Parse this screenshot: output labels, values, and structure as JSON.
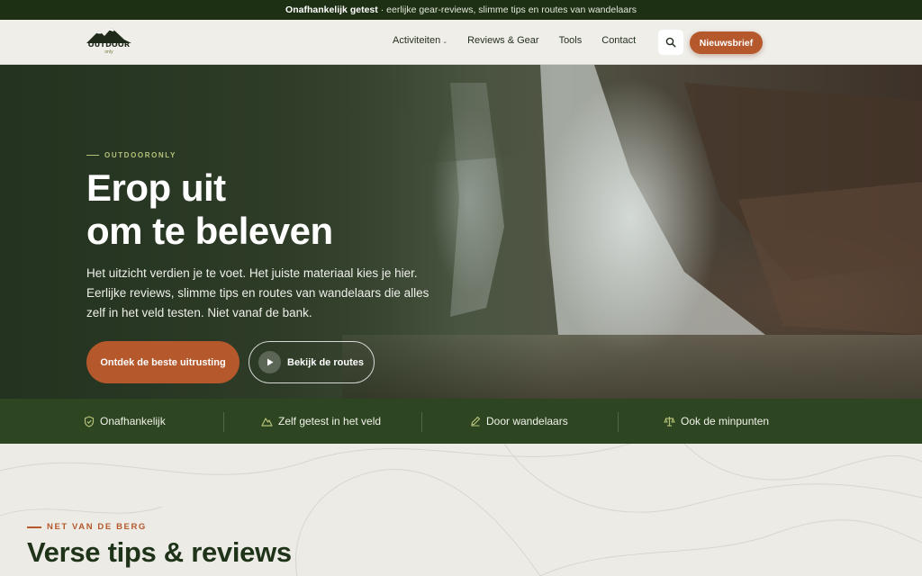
{
  "topbar": {
    "bold": "Onafhankelijk getest",
    "rest": "· eerlijke gear-reviews, slimme tips en routes van wandelaars"
  },
  "nav": {
    "logo_text": "OUTDOOR",
    "logo_sub": "only",
    "links": [
      {
        "label": "Activiteiten",
        "has_dropdown": true
      },
      {
        "label": "Reviews & Gear"
      },
      {
        "label": "Tools"
      },
      {
        "label": "Contact"
      }
    ],
    "search_icon": "search-icon",
    "newsletter_label": "Nieuwsbrief"
  },
  "hero": {
    "eyebrow": "OUTDOORONLY",
    "title_line1": "Erop uit",
    "title_line2": "om te beleven",
    "text": "Het uitzicht verdien je te voet. Het juiste materiaal kies je hier. Eerlijke reviews, slimme tips en routes van wandelaars die alles zelf in het veld testen. Niet vanaf de bank.",
    "cta_primary": "Ontdek de beste uitrusting",
    "cta_secondary": "Bekijk de routes"
  },
  "features": [
    {
      "label": "Onafhankelijk",
      "icon": "shield-check-icon"
    },
    {
      "label": "Zelf getest in het veld",
      "icon": "mountain-icon"
    },
    {
      "label": "Door wandelaars",
      "icon": "pencil-icon"
    },
    {
      "label": "Ook de minpunten",
      "icon": "scale-icon"
    }
  ],
  "section": {
    "eyebrow": "NET VAN DE BERG",
    "title": "Verse tips & reviews"
  },
  "colors": {
    "accent": "#b5582b",
    "dark_green": "#1e3014",
    "feature_green": "#2d4520",
    "eyebrow_green": "#b4c07a"
  }
}
